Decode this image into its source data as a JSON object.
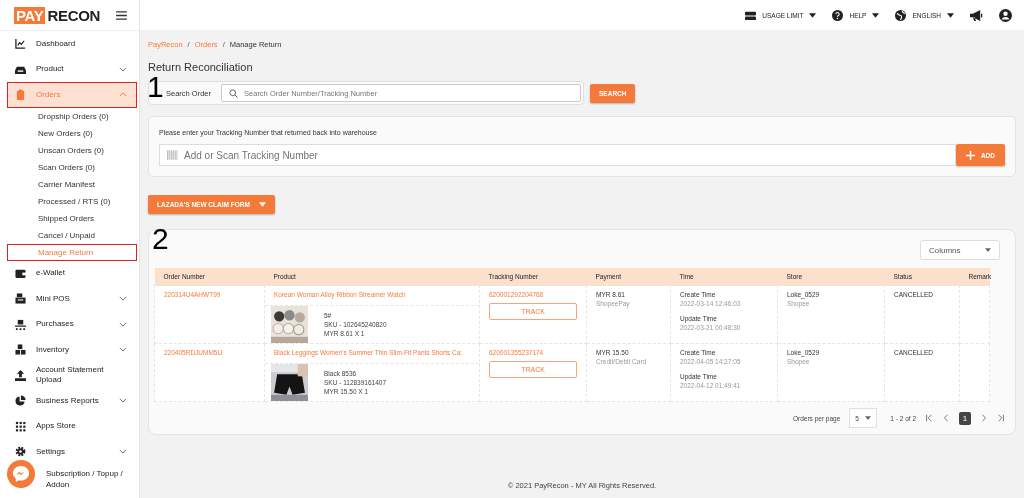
{
  "logo": {
    "part1": "PAY",
    "part2": "RECON"
  },
  "top_bar": {
    "menus": [
      {
        "label": "USAGE LIMIT"
      },
      {
        "label": "HELP"
      },
      {
        "label": "ENGLISH"
      }
    ]
  },
  "sidebar": {
    "items": [
      {
        "label": "Dashboard",
        "kind": "link",
        "selected": false,
        "annotated": false
      },
      {
        "label": "Product",
        "kind": "group",
        "expanded": false,
        "selected": false,
        "annotated": false
      },
      {
        "label": "Orders",
        "kind": "group",
        "expanded": true,
        "selected": true,
        "annotated": true,
        "children": [
          {
            "label": "Dropship Orders (0)",
            "selected": false,
            "annotated": false
          },
          {
            "label": "New Orders (0)",
            "selected": false,
            "annotated": false
          },
          {
            "label": "Unscan Orders (0)",
            "selected": false,
            "annotated": false
          },
          {
            "label": "Scan Orders (0)",
            "selected": false,
            "annotated": false
          },
          {
            "label": "Carrier Manifest",
            "selected": false,
            "annotated": false
          },
          {
            "label": "Processed / RTS (0)",
            "selected": false,
            "annotated": false
          },
          {
            "label": "Shipped Orders",
            "selected": false,
            "annotated": false
          },
          {
            "label": "Cancel / Unpaid",
            "selected": false,
            "annotated": false
          },
          {
            "label": "Manage Return",
            "selected": true,
            "annotated": true
          }
        ]
      },
      {
        "label": "e-Wallet",
        "kind": "link",
        "selected": false,
        "annotated": false
      },
      {
        "label": "Mini POS",
        "kind": "group",
        "expanded": false,
        "selected": false,
        "annotated": false
      },
      {
        "label": "Purchases",
        "kind": "group",
        "expanded": false,
        "selected": false,
        "annotated": false
      },
      {
        "label": "Inventory",
        "kind": "group",
        "expanded": false,
        "selected": false,
        "annotated": false
      },
      {
        "label": "Account Statement Upload",
        "kind": "link",
        "selected": false,
        "annotated": false
      },
      {
        "label": "Business Reports",
        "kind": "group",
        "expanded": false,
        "selected": false,
        "annotated": false
      },
      {
        "label": "Apps Store",
        "kind": "link",
        "selected": false,
        "annotated": false
      },
      {
        "label": "Settings",
        "kind": "group",
        "expanded": false,
        "selected": false,
        "annotated": false
      },
      {
        "label": "Subscription / Topup / Addon",
        "kind": "link",
        "selected": false,
        "annotated": false
      }
    ]
  },
  "breadcrumb": [
    {
      "label": "PayRecon",
      "kind": "link"
    },
    {
      "label": "/",
      "kind": "separator"
    },
    {
      "label": "Orders",
      "kind": "link"
    },
    {
      "label": "/",
      "kind": "separator"
    },
    {
      "label": "Manage Return",
      "kind": "current"
    }
  ],
  "page_title": "Return Reconciliation",
  "annotation_markers": [
    "1",
    "2"
  ],
  "search": {
    "label": "Search Order",
    "placeholder": "Search Order Number/Tracking Number",
    "button": "SEARCH"
  },
  "tracking_card": {
    "instruction": "Please enter your Tracking Number that returned back into warehouse",
    "placeholder": "Add or Scan Tracking Number",
    "button": "ADD"
  },
  "claim_button": "LAZADA'S NEW CLAIM FORM",
  "columns_select": "Columns",
  "table": {
    "columns": [
      "Order Number",
      "Product",
      "Tracking Number",
      "Payment",
      "Time",
      "Store",
      "Status",
      "Remark"
    ],
    "rows": [
      {
        "order_number": "220314U4AHWT99",
        "product": {
          "name": "Korean Woman Alloy Ribbon Streamer Watch",
          "variant": "5#",
          "sku": "SKU - 102645240820",
          "price": "MYR 8.61 X 1"
        },
        "tracking_number": "620001292204768",
        "track_button": "TRACK",
        "payment": {
          "amount": "MYR 8.61",
          "method": "ShopeePay"
        },
        "time": {
          "create_label": "Create Time",
          "create_time": "2022-03-14 12:46:03",
          "update_label": "Update Time",
          "update_time": "2022-03-21 00:48:30"
        },
        "store": {
          "name": "Loke_0529",
          "platform": "Shopee"
        },
        "status": "CANCELLED"
      },
      {
        "order_number": "220405RDJUMM5U",
        "product": {
          "name": "Black Leggings Women's Summer Thin Slim-Fit Pants Shorts Ca:",
          "variant": "Black 8536",
          "sku": "SKU - 112839161407",
          "price": "MYR 15.50 X 1"
        },
        "tracking_number": "620001355237174",
        "track_button": "TRACK",
        "payment": {
          "amount": "MYR 15.50",
          "method": "Credit/Debit Card"
        },
        "time": {
          "create_label": "Create Time",
          "create_time": "2022-04-05 14:27:05",
          "update_label": "Update Time",
          "update_time": "2022-04-12 01:49:41"
        },
        "store": {
          "name": "Loke_0529",
          "platform": "Shopee"
        },
        "status": "CANCELLED"
      }
    ]
  },
  "pagination": {
    "label": "Orders per page",
    "per_page": "5",
    "range": "1 - 2 of 2",
    "pages": [
      {
        "label": "1",
        "selected": true
      }
    ]
  },
  "footer": "© 2021 PayRecon - MY All Rights Reserved."
}
